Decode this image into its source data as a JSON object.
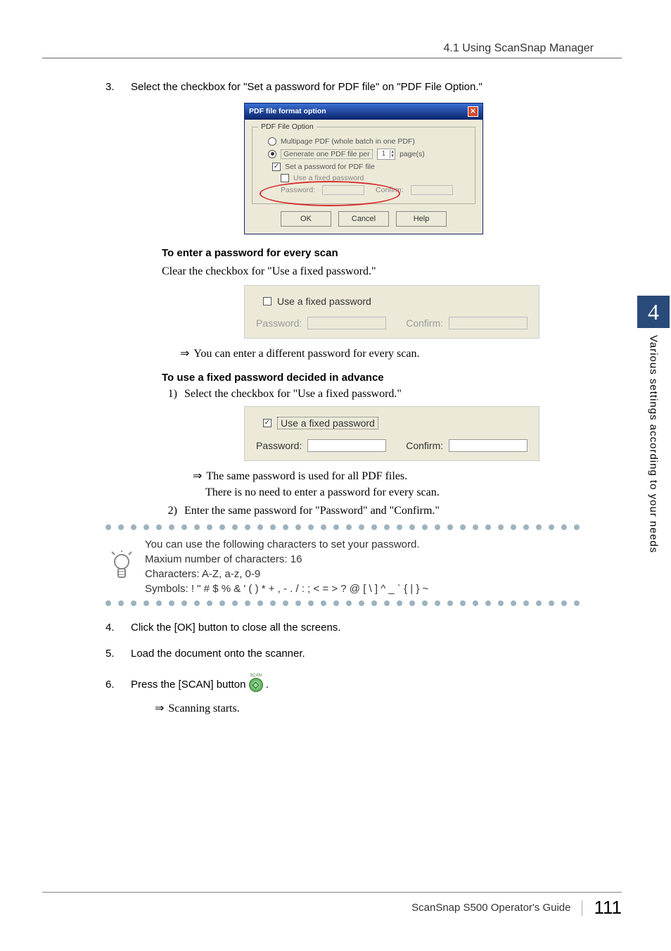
{
  "header": {
    "section": "4.1 Using ScanSnap Manager"
  },
  "sidebar": {
    "chapter_number": "4",
    "chapter_title": "Various settings according to your needs"
  },
  "step3": {
    "num": "3.",
    "text": "Select the checkbox for \"Set a password for PDF file\" on \"PDF File Option.\""
  },
  "dialog": {
    "title": "PDF file format option",
    "legend": "PDF File Option",
    "opt_multi": "Multipage PDF (whole batch in one PDF)",
    "opt_gen": "Generate one PDF file per",
    "pages_value": "1",
    "pages_unit": "page(s)",
    "set_pw": "Set a password for PDF file",
    "use_fixed": "Use a fixed password",
    "pw_label": "Password:",
    "confirm_label": "Confirm:",
    "btn_ok": "OK",
    "btn_cancel": "Cancel",
    "btn_help": "Help"
  },
  "sub1": {
    "title": "To enter a password for every scan",
    "line": "Clear the checkbox for \"Use a fixed password.\"",
    "panel": {
      "use_fixed": "Use a fixed password",
      "pw": "Password:",
      "confirm": "Confirm:"
    },
    "result": "You can enter a different password for every scan."
  },
  "sub2": {
    "title": "To use a fixed password decided in advance",
    "step1_num": "1)",
    "step1": "Select the checkbox for \"Use a fixed password.\"",
    "panel": {
      "use_fixed": "Use a fixed password",
      "pw": "Password:",
      "confirm": "Confirm:"
    },
    "result1": "The same password is used for all PDF files.",
    "result2": "There is no need to enter a password for every scan.",
    "step2_num": "2)",
    "step2": "Enter the same password for \"Password\" and \"Confirm.\""
  },
  "tip": {
    "line1": "You can use the following characters to set your password.",
    "line2": "Maxium number of characters: 16",
    "line3": "Characters: A-Z, a-z, 0-9",
    "line4": "Symbols: ! \" # $ % & ' ( ) * + , - . / : ; < = > ? @ [ \\ ] ^ _ ` { | } ~"
  },
  "step4": {
    "num": "4.",
    "text": "Click the [OK] button to close all the screens."
  },
  "step5": {
    "num": "5.",
    "text": "Load the document onto the scanner."
  },
  "step6": {
    "num": "6.",
    "text_before": "Press the [SCAN] button ",
    "text_after": " .",
    "result": "Scanning starts."
  },
  "footer": {
    "guide": "ScanSnap S500 Operator's Guide",
    "page": "111"
  }
}
